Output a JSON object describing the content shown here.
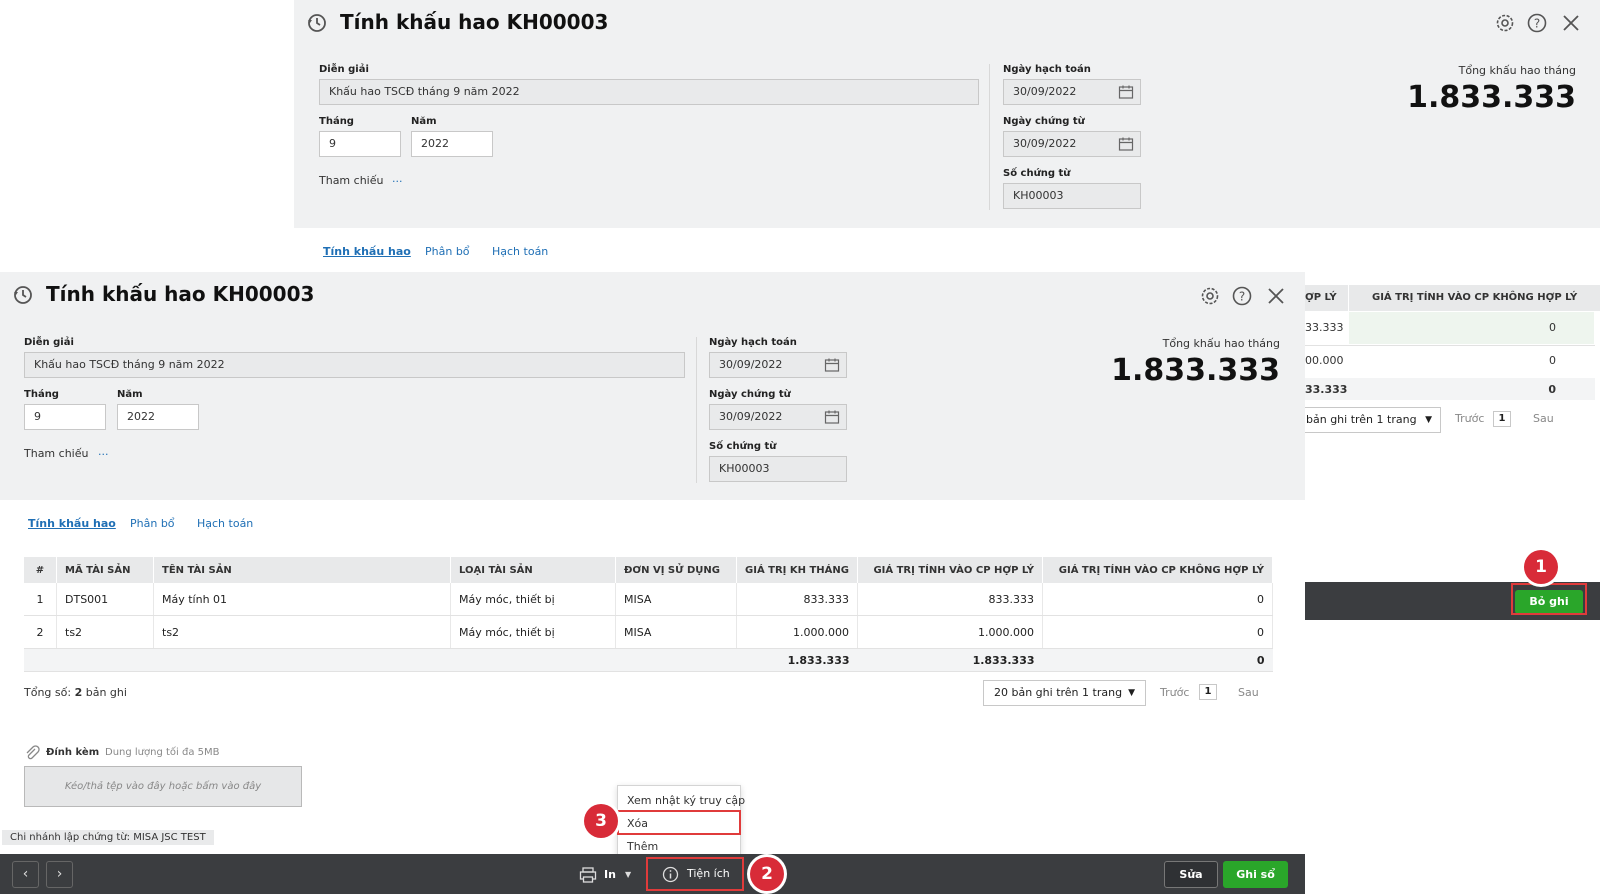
{
  "dialog": {
    "title": "Tính khấu hao KH00003",
    "fields": {
      "dien_giai_label": "Diễn giải",
      "dien_giai_value": "Khấu hao TSCĐ tháng 9 năm 2022",
      "thang_label": "Tháng",
      "thang_value": "9",
      "nam_label": "Năm",
      "nam_value": "2022",
      "tham_chieu_label": "Tham chiếu",
      "tham_chieu_link": "...",
      "ngay_hach_toan_label": "Ngày hạch toán",
      "ngay_hach_toan_value": "30/09/2022",
      "ngay_chung_tu_label": "Ngày chứng từ",
      "ngay_chung_tu_value": "30/09/2022",
      "so_chung_tu_label": "Số chứng từ",
      "so_chung_tu_value": "KH00003"
    },
    "summary": {
      "label": "Tổng khấu hao tháng",
      "value": "1.833.333"
    },
    "tabs": [
      {
        "label": "Tính khấu hao",
        "active": true
      },
      {
        "label": "Phân bổ",
        "active": false
      },
      {
        "label": "Hạch toán",
        "active": false
      }
    ]
  },
  "table": {
    "columns": [
      "#",
      "MÃ TÀI SẢN",
      "TÊN TÀI SẢN",
      "LOẠI TÀI SẢN",
      "ĐƠN VỊ SỬ DỤNG",
      "GIÁ TRỊ KH THÁNG",
      "GIÁ TRỊ TÍNH VÀO CP HỢP LÝ",
      "GIÁ TRỊ TÍNH VÀO CP KHÔNG HỢP LÝ"
    ],
    "rows": [
      [
        "1",
        "DTS001",
        "Máy tính 01",
        "Máy móc, thiết bị",
        "MISA",
        "833.333",
        "833.333",
        "0"
      ],
      [
        "2",
        "ts2",
        "ts2",
        "Máy móc, thiết bị",
        "MISA",
        "1.000.000",
        "1.000.000",
        "0"
      ]
    ],
    "totals": [
      "1.833.333",
      "1.833.333",
      "0"
    ],
    "record_count_prefix": "Tổng số:",
    "record_count": "2",
    "record_count_suffix": "bản ghi",
    "page_size": "20 bản ghi trên 1 trang",
    "prev": "Trước",
    "page": "1",
    "next": "Sau"
  },
  "back_table": {
    "col_partial": "ỢP LÝ",
    "col_full": "GIÁ TRỊ TÍNH VÀO CP KHÔNG HỢP LÝ",
    "rows": [
      [
        "33.333",
        "0"
      ],
      [
        "00.000",
        "0"
      ]
    ],
    "totals": [
      "33.333",
      "0"
    ],
    "page_size": "bản ghi trên 1 trang",
    "prev": "Trước",
    "page": "1",
    "next": "Sau",
    "unpost_button": "Bỏ ghi"
  },
  "attach": {
    "label": "Đính kèm",
    "hint": "Dung lượng tối đa 5MB",
    "drop_text": "Kéo/thả tệp vào đây hoặc bấm vào đây"
  },
  "branch_chip": "Chi nhánh lập chứng từ: MISA JSC TEST",
  "footer": {
    "print_label": "In",
    "utilities_label": "Tiện ích",
    "edit_button": "Sửa",
    "post_button": "Ghi sổ"
  },
  "menu_items": [
    "Xem nhật ký truy cập",
    "Xóa",
    "Thêm"
  ],
  "badges": [
    "1",
    "2",
    "3"
  ],
  "colors": {
    "accent": "#1f6fb5",
    "green": "#2aa62a",
    "highlight": "#e03b3b",
    "footer": "#3b3d40"
  }
}
